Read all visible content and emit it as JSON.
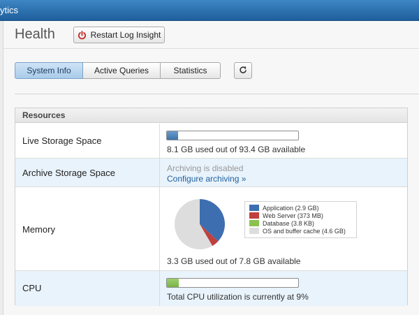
{
  "window": {
    "title_fragment": "ytics"
  },
  "page": {
    "title": "Health"
  },
  "toolbar": {
    "restart_label": "Restart Log Insight"
  },
  "tabs": [
    {
      "label": "System Info",
      "active": true
    },
    {
      "label": "Active Queries",
      "active": false
    },
    {
      "label": "Statistics",
      "active": false
    }
  ],
  "resources": {
    "header": "Resources",
    "live_storage": {
      "label": "Live Storage Space",
      "used_fraction": 0.087,
      "text": "8.1 GB used out of 93.4 GB available"
    },
    "archive_storage": {
      "label": "Archive Storage Space",
      "status": "Archiving is disabled",
      "link": "Configure archiving »"
    },
    "memory": {
      "label": "Memory",
      "text": "3.3 GB used out of 7.8 GB available",
      "legend": [
        {
          "label": "Application (2.9 GB)",
          "color": "#3d6fb0",
          "value_gb": 2.9
        },
        {
          "label": "Web Server (373 MB)",
          "color": "#c0403d",
          "value_gb": 0.373
        },
        {
          "label": "Database (3.8 KB)",
          "color": "#8bc24e",
          "value_gb": 3.8e-06
        },
        {
          "label": "OS and buffer cache (4.6 GB)",
          "color": "#dddddd",
          "value_gb": 4.6
        }
      ]
    },
    "cpu": {
      "label": "CPU",
      "used_fraction": 0.09,
      "text": "Total CPU utilization is currently at 9%"
    }
  },
  "colors": {
    "accent": "#2a6eb0",
    "row_highlight": "#e9f3fb"
  }
}
